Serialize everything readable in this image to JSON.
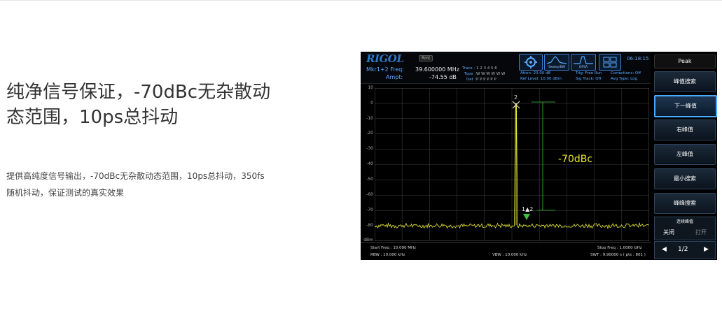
{
  "page": {
    "heading_line1": "纯净信号保证，-70dBc无杂散动",
    "heading_line2": "态范围，10ps总抖动",
    "description_line1": "提供高纯度信号输出，-70dBc无杂散动态范围，10ps总抖动，350fs",
    "description_line2": "随机抖动，保证测试的真实效果"
  },
  "analyzer": {
    "brand": "RIGOL",
    "mode_badge": "Rmt",
    "marker": {
      "freq_label": "Mkr1+2 Freq:",
      "freq_value": "39.600000 MHz",
      "ampt_label": "Ampt:",
      "ampt_value": "-74.55 dB"
    },
    "trace": {
      "trace_label": "Trace :",
      "trace_numbers": "1  2  3  4  5  6",
      "type_label": "Type :",
      "type_values": "W  W  W  W  W  W",
      "det_label": "Det :",
      "det_values": "P  P  P  P  P  P"
    },
    "status": {
      "atten": "Atten: 20.00 dB",
      "ref_level": "Ref Level: 10.00 dBm",
      "trig": "Trig: Free Run",
      "sig_track": "Sig Track: Off",
      "corrections": "Corrections: Off",
      "avg_type": "Avg Type: Log"
    },
    "tools": [
      "Sweep/BW",
      "GPSA"
    ],
    "time": "06:18:15",
    "y_unit": "dBm",
    "y_ticks": [
      "10",
      "0",
      "-10",
      "-20",
      "-30",
      "-40",
      "-50",
      "-60",
      "-70",
      "-80"
    ],
    "annotations": {
      "marker2_label": "2",
      "delta_label": "1▲2",
      "dbc_label": "-70dBc"
    },
    "footer": {
      "start_freq": "Start Freq : 10.000 MHz",
      "stop_freq": "Stop Freq : 1.0000 GHz",
      "rbw": "RBW : 10.000 kHz",
      "vbw": "VBW : 10.000 kHz",
      "swt": "SWT : 9.90000 s ( pts : 801 )"
    },
    "colors": {
      "trace": "#e6e62e",
      "marker_green": "#3cc23c",
      "grid": "#3a3a3a",
      "accent_blue": "#4aa8ff"
    },
    "menu": {
      "title": "Peak",
      "buttons": [
        "峰值搜索",
        "下一峰值",
        "右峰值",
        "左峰值",
        "最小搜索",
        "峰峰搜索"
      ],
      "active_index": 1,
      "toggle_title": "连续峰值",
      "toggle_off": "关闭",
      "toggle_on": "打开",
      "page_indicator": "1/2"
    }
  }
}
